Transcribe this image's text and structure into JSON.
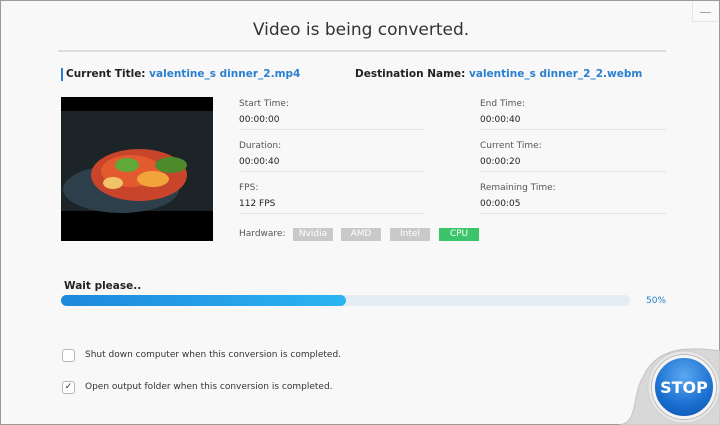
{
  "window": {
    "title": "Video is being converted.",
    "minimize_icon": "minimize-icon"
  },
  "files": {
    "current_label": "Current Title:",
    "current_value": "valentine_s dinner_2.mp4",
    "dest_label": "Destination Name:",
    "dest_value": "valentine_s dinner_2_2.webm"
  },
  "info": {
    "start_label": "Start Time:",
    "start_value": "00:00:00",
    "end_label": "End Time:",
    "end_value": "00:00:40",
    "duration_label": "Duration:",
    "duration_value": "00:00:40",
    "current_label": "Current Time:",
    "current_value": "00:00:20",
    "fps_label": "FPS:",
    "fps_value": "112 FPS",
    "remaining_label": "Remaining Time:",
    "remaining_value": "00:00:05"
  },
  "hardware": {
    "label": "Hardware:",
    "options": [
      {
        "label": "Nvidia",
        "active": false
      },
      {
        "label": "AMD",
        "active": false
      },
      {
        "label": "Intel",
        "active": false
      },
      {
        "label": "CPU",
        "active": true
      }
    ]
  },
  "progress": {
    "status": "Wait please..",
    "percent": 50,
    "percent_label": "50%"
  },
  "options": [
    {
      "label": "Shut down computer when this conversion is completed.",
      "checked": false
    },
    {
      "label": "Open output folder when this conversion is completed.",
      "checked": true
    }
  ],
  "stop_label": "STOP",
  "colors": {
    "accent": "#2a7fd0",
    "active_chip": "#3cc46a",
    "stop": "#1a6fd0"
  }
}
